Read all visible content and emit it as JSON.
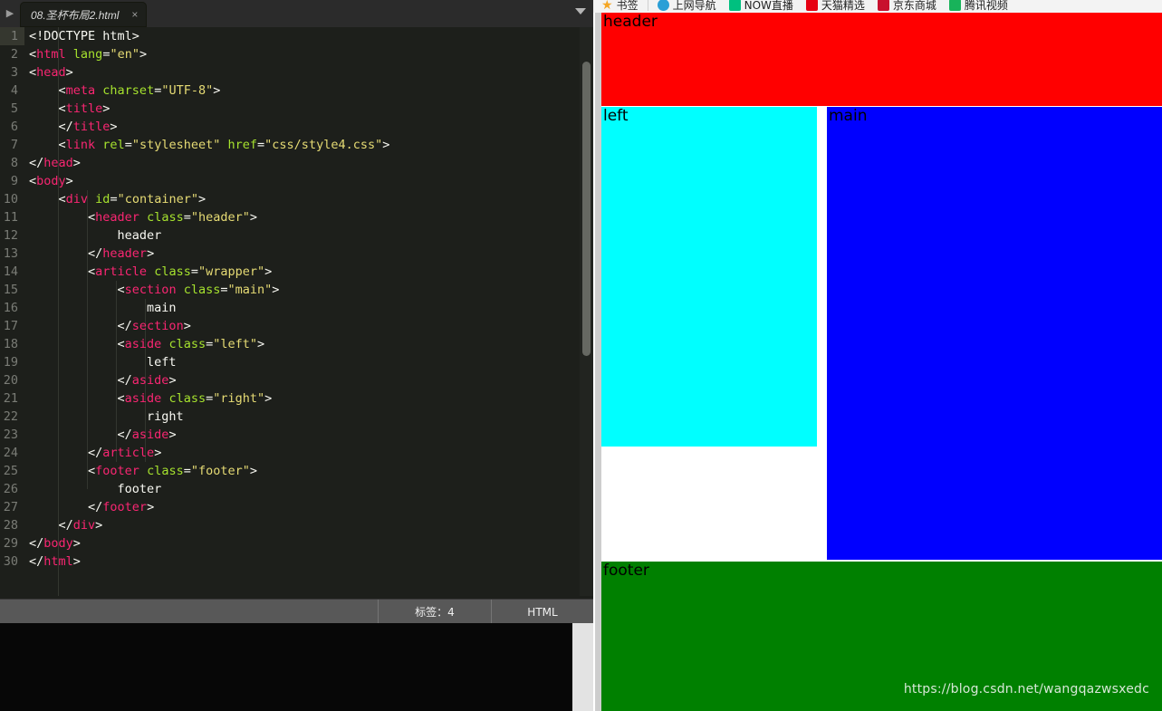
{
  "editor": {
    "tab": {
      "title": "08.圣杯布局2.html",
      "close_label": "×"
    },
    "nav": {
      "left_arrow": "▶",
      "right_arrow": "▼"
    },
    "statusbar": {
      "tags_label": "标签：4",
      "language_label": "HTML"
    },
    "code_lines": [
      {
        "n": "1",
        "tokens": [
          {
            "t": "punct",
            "v": "<!DOCTYPE html>"
          }
        ]
      },
      {
        "n": "2",
        "tokens": [
          {
            "t": "punct",
            "v": "<"
          },
          {
            "t": "tag",
            "v": "html"
          },
          {
            "t": "punct",
            "v": " "
          },
          {
            "t": "attr",
            "v": "lang"
          },
          {
            "t": "punct",
            "v": "="
          },
          {
            "t": "str",
            "v": "\"en\""
          },
          {
            "t": "punct",
            "v": ">"
          }
        ]
      },
      {
        "n": "3",
        "tokens": [
          {
            "t": "punct",
            "v": "<"
          },
          {
            "t": "tag",
            "v": "head"
          },
          {
            "t": "punct",
            "v": ">"
          }
        ]
      },
      {
        "n": "4",
        "tokens": [
          {
            "t": "punct",
            "v": "    <"
          },
          {
            "t": "tag",
            "v": "meta"
          },
          {
            "t": "punct",
            "v": " "
          },
          {
            "t": "attr",
            "v": "charset"
          },
          {
            "t": "punct",
            "v": "="
          },
          {
            "t": "str",
            "v": "\"UTF-8\""
          },
          {
            "t": "punct",
            "v": ">"
          }
        ]
      },
      {
        "n": "5",
        "tokens": [
          {
            "t": "punct",
            "v": "    <"
          },
          {
            "t": "tag",
            "v": "title"
          },
          {
            "t": "punct",
            "v": ">"
          }
        ]
      },
      {
        "n": "6",
        "tokens": [
          {
            "t": "punct",
            "v": "    </"
          },
          {
            "t": "tag",
            "v": "title"
          },
          {
            "t": "punct",
            "v": ">"
          }
        ]
      },
      {
        "n": "7",
        "tokens": [
          {
            "t": "punct",
            "v": "    <"
          },
          {
            "t": "tag",
            "v": "link"
          },
          {
            "t": "punct",
            "v": " "
          },
          {
            "t": "attr",
            "v": "rel"
          },
          {
            "t": "punct",
            "v": "="
          },
          {
            "t": "str",
            "v": "\"stylesheet\""
          },
          {
            "t": "punct",
            "v": " "
          },
          {
            "t": "attr",
            "v": "href"
          },
          {
            "t": "punct",
            "v": "="
          },
          {
            "t": "str",
            "v": "\"css/style4.css\""
          },
          {
            "t": "punct",
            "v": ">"
          }
        ]
      },
      {
        "n": "8",
        "tokens": [
          {
            "t": "punct",
            "v": "</"
          },
          {
            "t": "tag",
            "v": "head"
          },
          {
            "t": "punct",
            "v": ">"
          }
        ]
      },
      {
        "n": "9",
        "tokens": [
          {
            "t": "punct",
            "v": "<"
          },
          {
            "t": "tag",
            "v": "body"
          },
          {
            "t": "punct",
            "v": ">"
          }
        ]
      },
      {
        "n": "10",
        "tokens": [
          {
            "t": "punct",
            "v": "    <"
          },
          {
            "t": "tag",
            "v": "div"
          },
          {
            "t": "punct",
            "v": " "
          },
          {
            "t": "attr",
            "v": "id"
          },
          {
            "t": "punct",
            "v": "="
          },
          {
            "t": "str",
            "v": "\"container\""
          },
          {
            "t": "punct",
            "v": ">"
          }
        ]
      },
      {
        "n": "11",
        "tokens": [
          {
            "t": "punct",
            "v": "        <"
          },
          {
            "t": "tag",
            "v": "header"
          },
          {
            "t": "punct",
            "v": " "
          },
          {
            "t": "attr",
            "v": "class"
          },
          {
            "t": "punct",
            "v": "="
          },
          {
            "t": "str",
            "v": "\"header\""
          },
          {
            "t": "punct",
            "v": ">"
          }
        ]
      },
      {
        "n": "12",
        "tokens": [
          {
            "t": "txt",
            "v": "            header"
          }
        ]
      },
      {
        "n": "13",
        "tokens": [
          {
            "t": "punct",
            "v": "        </"
          },
          {
            "t": "tag",
            "v": "header"
          },
          {
            "t": "punct",
            "v": ">"
          }
        ]
      },
      {
        "n": "14",
        "tokens": [
          {
            "t": "punct",
            "v": "        <"
          },
          {
            "t": "tag",
            "v": "article"
          },
          {
            "t": "punct",
            "v": " "
          },
          {
            "t": "attr",
            "v": "class"
          },
          {
            "t": "punct",
            "v": "="
          },
          {
            "t": "str",
            "v": "\"wrapper\""
          },
          {
            "t": "punct",
            "v": ">"
          }
        ]
      },
      {
        "n": "15",
        "tokens": [
          {
            "t": "punct",
            "v": "            <"
          },
          {
            "t": "tag",
            "v": "section"
          },
          {
            "t": "punct",
            "v": " "
          },
          {
            "t": "attr",
            "v": "class"
          },
          {
            "t": "punct",
            "v": "="
          },
          {
            "t": "str",
            "v": "\"main\""
          },
          {
            "t": "punct",
            "v": ">"
          }
        ]
      },
      {
        "n": "16",
        "tokens": [
          {
            "t": "txt",
            "v": "                main"
          }
        ]
      },
      {
        "n": "17",
        "tokens": [
          {
            "t": "punct",
            "v": "            </"
          },
          {
            "t": "tag",
            "v": "section"
          },
          {
            "t": "punct",
            "v": ">"
          }
        ]
      },
      {
        "n": "18",
        "tokens": [
          {
            "t": "punct",
            "v": "            <"
          },
          {
            "t": "tag",
            "v": "aside"
          },
          {
            "t": "punct",
            "v": " "
          },
          {
            "t": "attr",
            "v": "class"
          },
          {
            "t": "punct",
            "v": "="
          },
          {
            "t": "str",
            "v": "\"left\""
          },
          {
            "t": "punct",
            "v": ">"
          }
        ]
      },
      {
        "n": "19",
        "tokens": [
          {
            "t": "txt",
            "v": "                left"
          }
        ]
      },
      {
        "n": "20",
        "tokens": [
          {
            "t": "punct",
            "v": "            </"
          },
          {
            "t": "tag",
            "v": "aside"
          },
          {
            "t": "punct",
            "v": ">"
          }
        ]
      },
      {
        "n": "21",
        "tokens": [
          {
            "t": "punct",
            "v": "            <"
          },
          {
            "t": "tag",
            "v": "aside"
          },
          {
            "t": "punct",
            "v": " "
          },
          {
            "t": "attr",
            "v": "class"
          },
          {
            "t": "punct",
            "v": "="
          },
          {
            "t": "str",
            "v": "\"right\""
          },
          {
            "t": "punct",
            "v": ">"
          }
        ]
      },
      {
        "n": "22",
        "tokens": [
          {
            "t": "txt",
            "v": "                right"
          }
        ]
      },
      {
        "n": "23",
        "tokens": [
          {
            "t": "punct",
            "v": "            </"
          },
          {
            "t": "tag",
            "v": "aside"
          },
          {
            "t": "punct",
            "v": ">"
          }
        ]
      },
      {
        "n": "24",
        "tokens": [
          {
            "t": "punct",
            "v": "        </"
          },
          {
            "t": "tag",
            "v": "article"
          },
          {
            "t": "punct",
            "v": ">"
          }
        ]
      },
      {
        "n": "25",
        "tokens": [
          {
            "t": "punct",
            "v": "        <"
          },
          {
            "t": "tag",
            "v": "footer"
          },
          {
            "t": "punct",
            "v": " "
          },
          {
            "t": "attr",
            "v": "class"
          },
          {
            "t": "punct",
            "v": "="
          },
          {
            "t": "str",
            "v": "\"footer\""
          },
          {
            "t": "punct",
            "v": ">"
          }
        ]
      },
      {
        "n": "26",
        "tokens": [
          {
            "t": "txt",
            "v": "            footer"
          }
        ]
      },
      {
        "n": "27",
        "tokens": [
          {
            "t": "punct",
            "v": "        </"
          },
          {
            "t": "tag",
            "v": "footer"
          },
          {
            "t": "punct",
            "v": ">"
          }
        ]
      },
      {
        "n": "28",
        "tokens": [
          {
            "t": "punct",
            "v": "    </"
          },
          {
            "t": "tag",
            "v": "div"
          },
          {
            "t": "punct",
            "v": ">"
          }
        ]
      },
      {
        "n": "29",
        "tokens": [
          {
            "t": "punct",
            "v": "</"
          },
          {
            "t": "tag",
            "v": "body"
          },
          {
            "t": "punct",
            "v": ">"
          }
        ]
      },
      {
        "n": "30",
        "tokens": [
          {
            "t": "punct",
            "v": "</"
          },
          {
            "t": "tag",
            "v": "html"
          },
          {
            "t": "punct",
            "v": ">"
          }
        ]
      }
    ]
  },
  "browser": {
    "bookmarks": [
      {
        "label": "书签",
        "icon": "star-icon",
        "color": "#f5a623",
        "kind": "star"
      },
      {
        "label": "上网导航",
        "icon": "edge-browser-icon",
        "color": "#2a9fd6",
        "kind": "circle"
      },
      {
        "label": "NOW直播",
        "icon": "now-live-icon",
        "color": "#00c07f",
        "kind": "square"
      },
      {
        "label": "天猫精选",
        "icon": "tmall-icon",
        "color": "#e60012",
        "kind": "square"
      },
      {
        "label": "京东商城",
        "icon": "jd-icon",
        "color": "#c8102e",
        "kind": "square"
      },
      {
        "label": "腾讯视频",
        "icon": "tencent-video-icon",
        "color": "#18b35a",
        "kind": "square"
      }
    ],
    "page": {
      "blocks": [
        {
          "name": "header",
          "label": "header",
          "color": "#ff0000"
        },
        {
          "name": "left",
          "label": "left",
          "color": "#00ffff"
        },
        {
          "name": "main",
          "label": "main",
          "color": "#0000ff"
        },
        {
          "name": "footer",
          "label": "footer",
          "color": "#008000"
        }
      ],
      "watermark": "https://blog.csdn.net/wangqazwsxedc"
    }
  }
}
